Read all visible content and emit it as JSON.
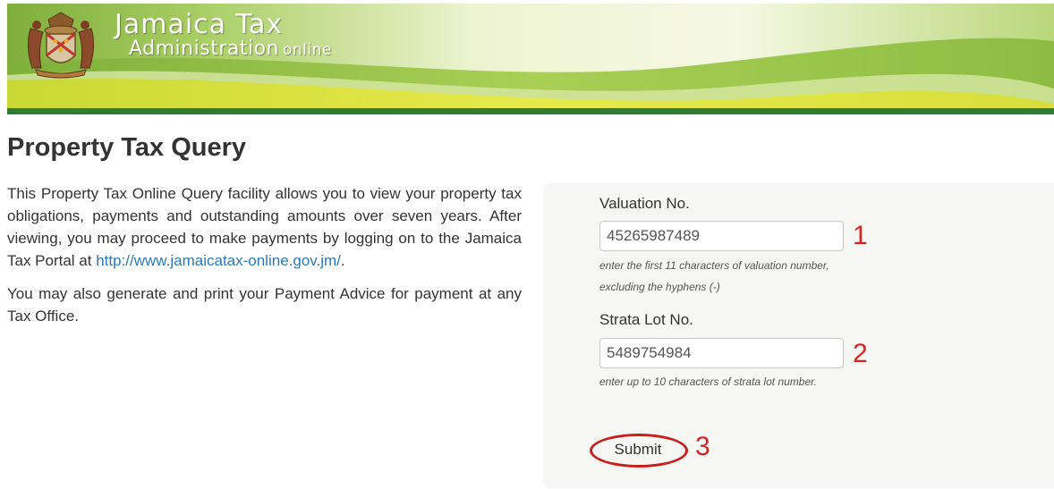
{
  "header": {
    "title_main": "Jamaica Tax",
    "title_sub": "Administration",
    "title_sub_small": "online",
    "crest_icon": "coat-of-arms-icon",
    "colors": {
      "banner_light": "#f2f6d8",
      "banner_green": "#8fbd48",
      "banner_yellow": "#d8de3a",
      "banner_bottom": "#2e7d32"
    }
  },
  "page": {
    "title": "Property Tax Query"
  },
  "intro": {
    "paragraph1_text": "This Property Tax Online Query facility allows you to view your property tax obligations, payments and outstanding amounts over seven years. After viewing, you may proceed to make payments by logging on to the Jamaica Tax Portal at ",
    "portal_link": "http://www.jamaicatax-online.gov.jm/",
    "paragraph1_end": ".",
    "paragraph2": "You may also generate and print your Payment Advice for payment at any Tax Office."
  },
  "form": {
    "valuation": {
      "label": "Valuation No.",
      "value": "45265987489",
      "hint_line1": "enter the first 11 characters of valuation number,",
      "hint_line2": "excluding the hyphens (-)"
    },
    "strata": {
      "label": "Strata Lot No.",
      "value": "5489754984",
      "hint": "enter up to 10 characters of strata lot number."
    },
    "submit_label": "Submit"
  },
  "annotations": {
    "step1": "1",
    "step2": "2",
    "step3": "3",
    "color": "#d42424"
  }
}
